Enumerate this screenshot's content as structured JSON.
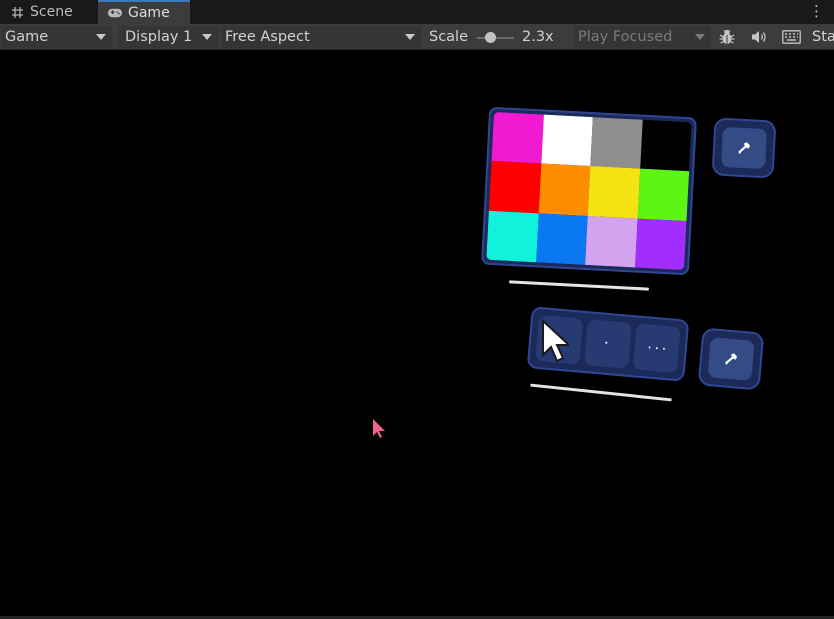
{
  "tabs": {
    "scene_label": "Scene",
    "game_label": "Game"
  },
  "toolbar": {
    "view_mode": "Game",
    "display": "Display 1",
    "aspect": "Free Aspect",
    "scale_label": "Scale",
    "scale_value": "2.3x",
    "scale_level": 0.23,
    "play_mode": "Play Focused",
    "stats_label": "Stats",
    "icons": [
      "bug-icon",
      "audio-icon",
      "keyboard-icon",
      "kebab-menu-icon"
    ]
  },
  "game": {
    "palette_colors": [
      "#ef1ad2",
      "#ffffff",
      "#8e8e8e",
      "#000000",
      "#ff0000",
      "#ff8d00",
      "#f6e312",
      "#5df514",
      "#11f2dc",
      "#0a78f2",
      "#d4a3ef",
      "#a12dff"
    ],
    "tool_buttons": [
      "pointer",
      "dot",
      "ellipsis"
    ],
    "tool_dot_glyph": "⠂",
    "tool_ellipsis_glyph": "···",
    "side_icon": "eyedropper-icon",
    "panel_color": "#1c2a5a",
    "panel_border": "#2f4793",
    "cursor_color": "#f06292"
  }
}
